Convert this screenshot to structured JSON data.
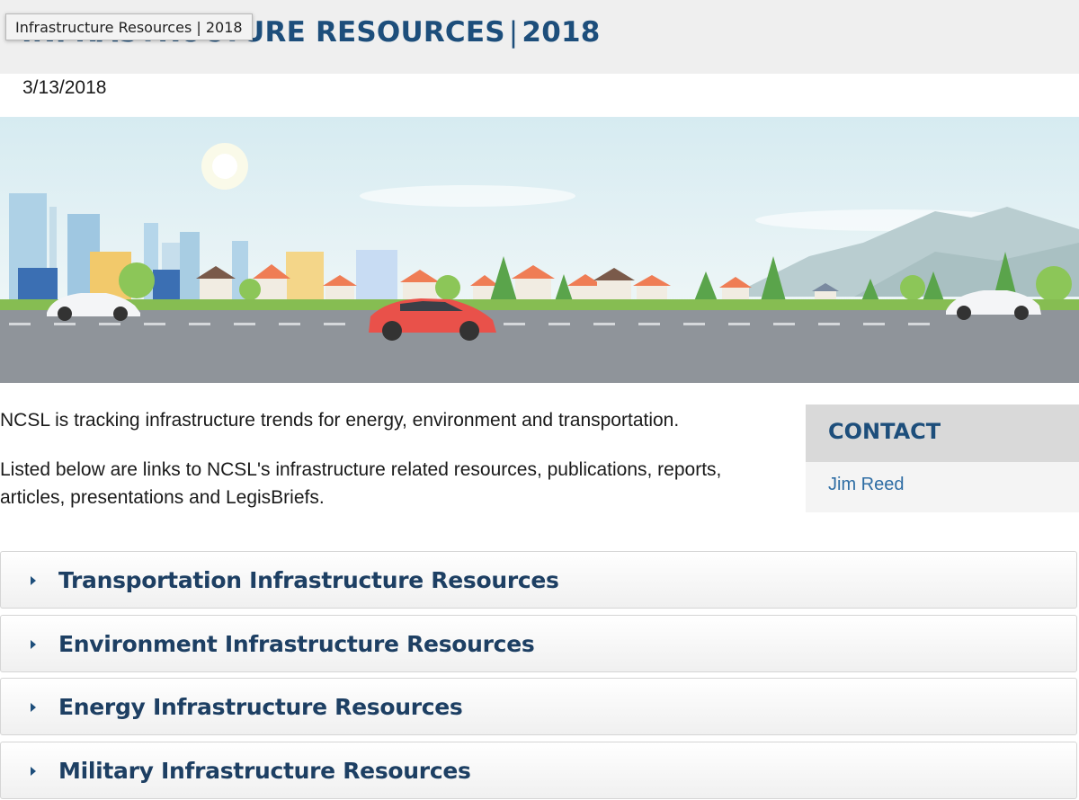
{
  "tooltip": "Infrastructure Resources | 2018",
  "page": {
    "title_main": "INFRASTRUCTURE RESOURCES",
    "title_sep": "|",
    "title_year": "2018",
    "date": "3/13/2018"
  },
  "intro": {
    "p1": "NCSL is tracking infrastructure trends for energy, environment and transportation.",
    "p2": "Listed below are links to NCSL's infrastructure related resources, publications, reports, articles, presentations and LegisBriefs."
  },
  "contact": {
    "heading": "CONTACT",
    "name": "Jim Reed"
  },
  "accordions": [
    {
      "label": "Transportation Infrastructure Resources"
    },
    {
      "label": "Environment Infrastructure Resources"
    },
    {
      "label": "Energy Infrastructure Resources"
    },
    {
      "label": "Military Infrastructure Resources"
    }
  ],
  "colors": {
    "title": "#1d4e7b",
    "accordion_text": "#1d3f63",
    "link": "#2e6da4"
  }
}
